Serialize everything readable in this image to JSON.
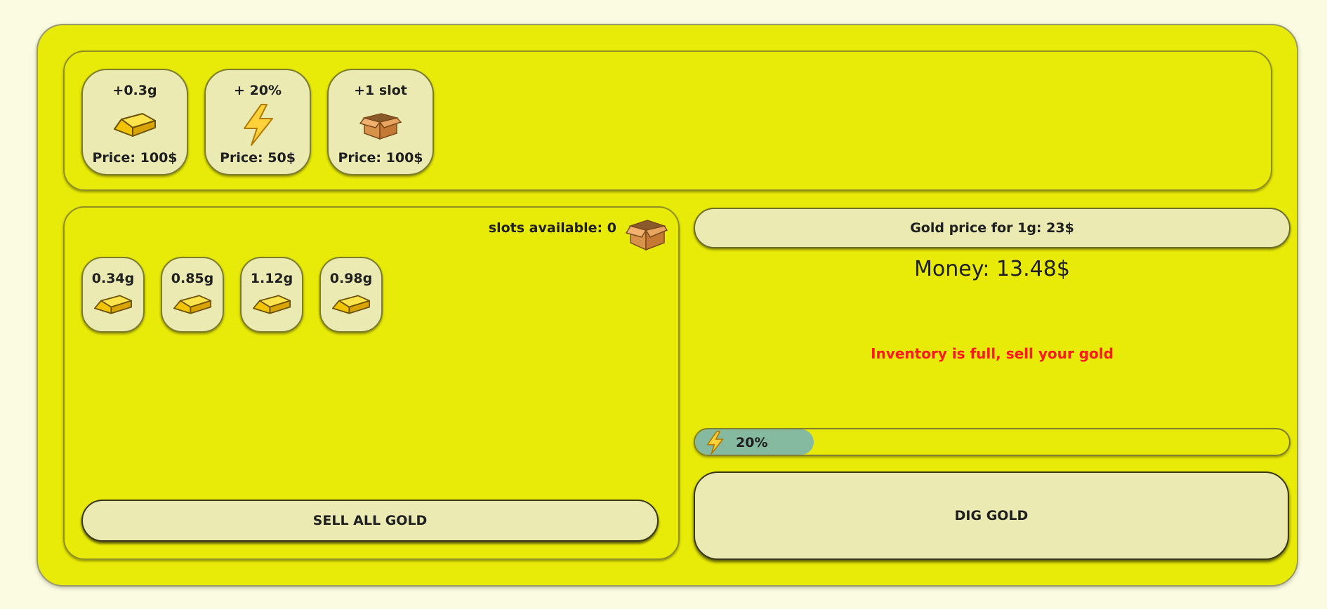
{
  "shop": {
    "items": [
      {
        "label": "+0.3g",
        "price": "Price: 100$",
        "icon": "gold-bar-icon"
      },
      {
        "label": "+ 20%",
        "price": "Price: 50$",
        "icon": "lightning-icon"
      },
      {
        "label": "+1 slot",
        "price": "Price: 100$",
        "icon": "box-icon"
      }
    ]
  },
  "inventory": {
    "slots_label": "slots available: 0",
    "items": [
      {
        "weight": "0.34g"
      },
      {
        "weight": "0.85g"
      },
      {
        "weight": "1.12g"
      },
      {
        "weight": "0.98g"
      }
    ],
    "sell_label": "SELL ALL GOLD"
  },
  "market": {
    "gold_price": "Gold price for 1g: 23$",
    "money": "Money: 13.48$",
    "warning": "Inventory is full, sell your gold"
  },
  "energy": {
    "label": "20%",
    "level": 0.2
  },
  "dig_label": "DIG GOLD",
  "colors": {
    "panel": "#e8ea07",
    "card": "#eaeab2",
    "energy": "#85b9a0",
    "warning": "#ff1a1a"
  }
}
